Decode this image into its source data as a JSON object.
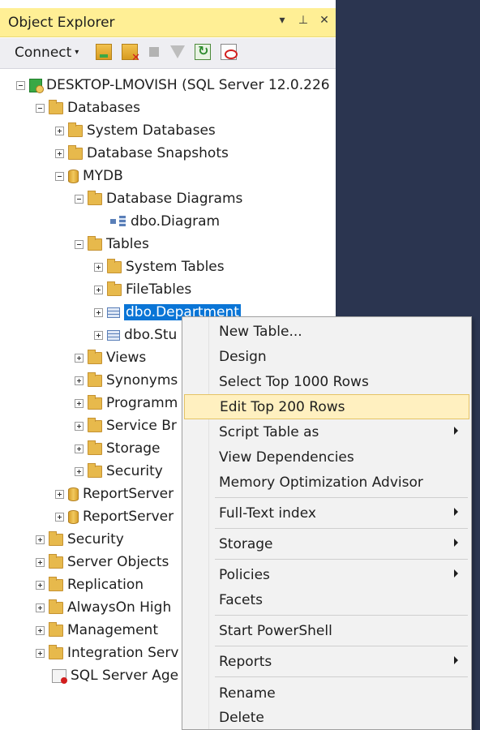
{
  "panel": {
    "title": "Object Explorer",
    "buttons": [
      "▾",
      "⊥",
      "✕"
    ]
  },
  "toolbar": {
    "connect_label": "Connect",
    "connect_caret": "▾"
  },
  "tree": {
    "server": "DESKTOP-LMOVISH (SQL Server 12.0.226",
    "databases": "Databases",
    "system_databases": "System Databases",
    "database_snapshots": "Database Snapshots",
    "mydb": "MYDB",
    "database_diagrams": "Database Diagrams",
    "dbo_diagram": "dbo.Diagram",
    "tables": "Tables",
    "system_tables": "System Tables",
    "filetables": "FileTables",
    "dbo_department": "dbo.Department",
    "dbo_student": "dbo.Stu",
    "views": "Views",
    "synonyms": "Synonyms",
    "programmability": "Programm",
    "service_broker": "Service Br",
    "storage": "Storage",
    "security_db": "Security",
    "reportserver1": "ReportServer",
    "reportserver2": "ReportServer",
    "security": "Security",
    "server_objects": "Server Objects",
    "replication": "Replication",
    "alwayson": "AlwaysOn High",
    "management": "Management",
    "integration": "Integration Serv",
    "sql_agent": "SQL Server Age"
  },
  "context_menu": {
    "new_table": "New Table...",
    "design": "Design",
    "select_top": "Select Top 1000 Rows",
    "edit_top": "Edit Top 200 Rows",
    "script_table": "Script Table as",
    "view_dependencies": "View Dependencies",
    "memory_advisor": "Memory Optimization Advisor",
    "fulltext": "Full-Text index",
    "storage": "Storage",
    "policies": "Policies",
    "facets": "Facets",
    "powershell": "Start PowerShell",
    "reports": "Reports",
    "rename": "Rename",
    "delete": "Delete"
  },
  "colors": {
    "title_bar": "#ffef95",
    "selection": "#0a75d6",
    "menu_highlight": "#fff0c0",
    "background_dark": "#2b3550"
  }
}
